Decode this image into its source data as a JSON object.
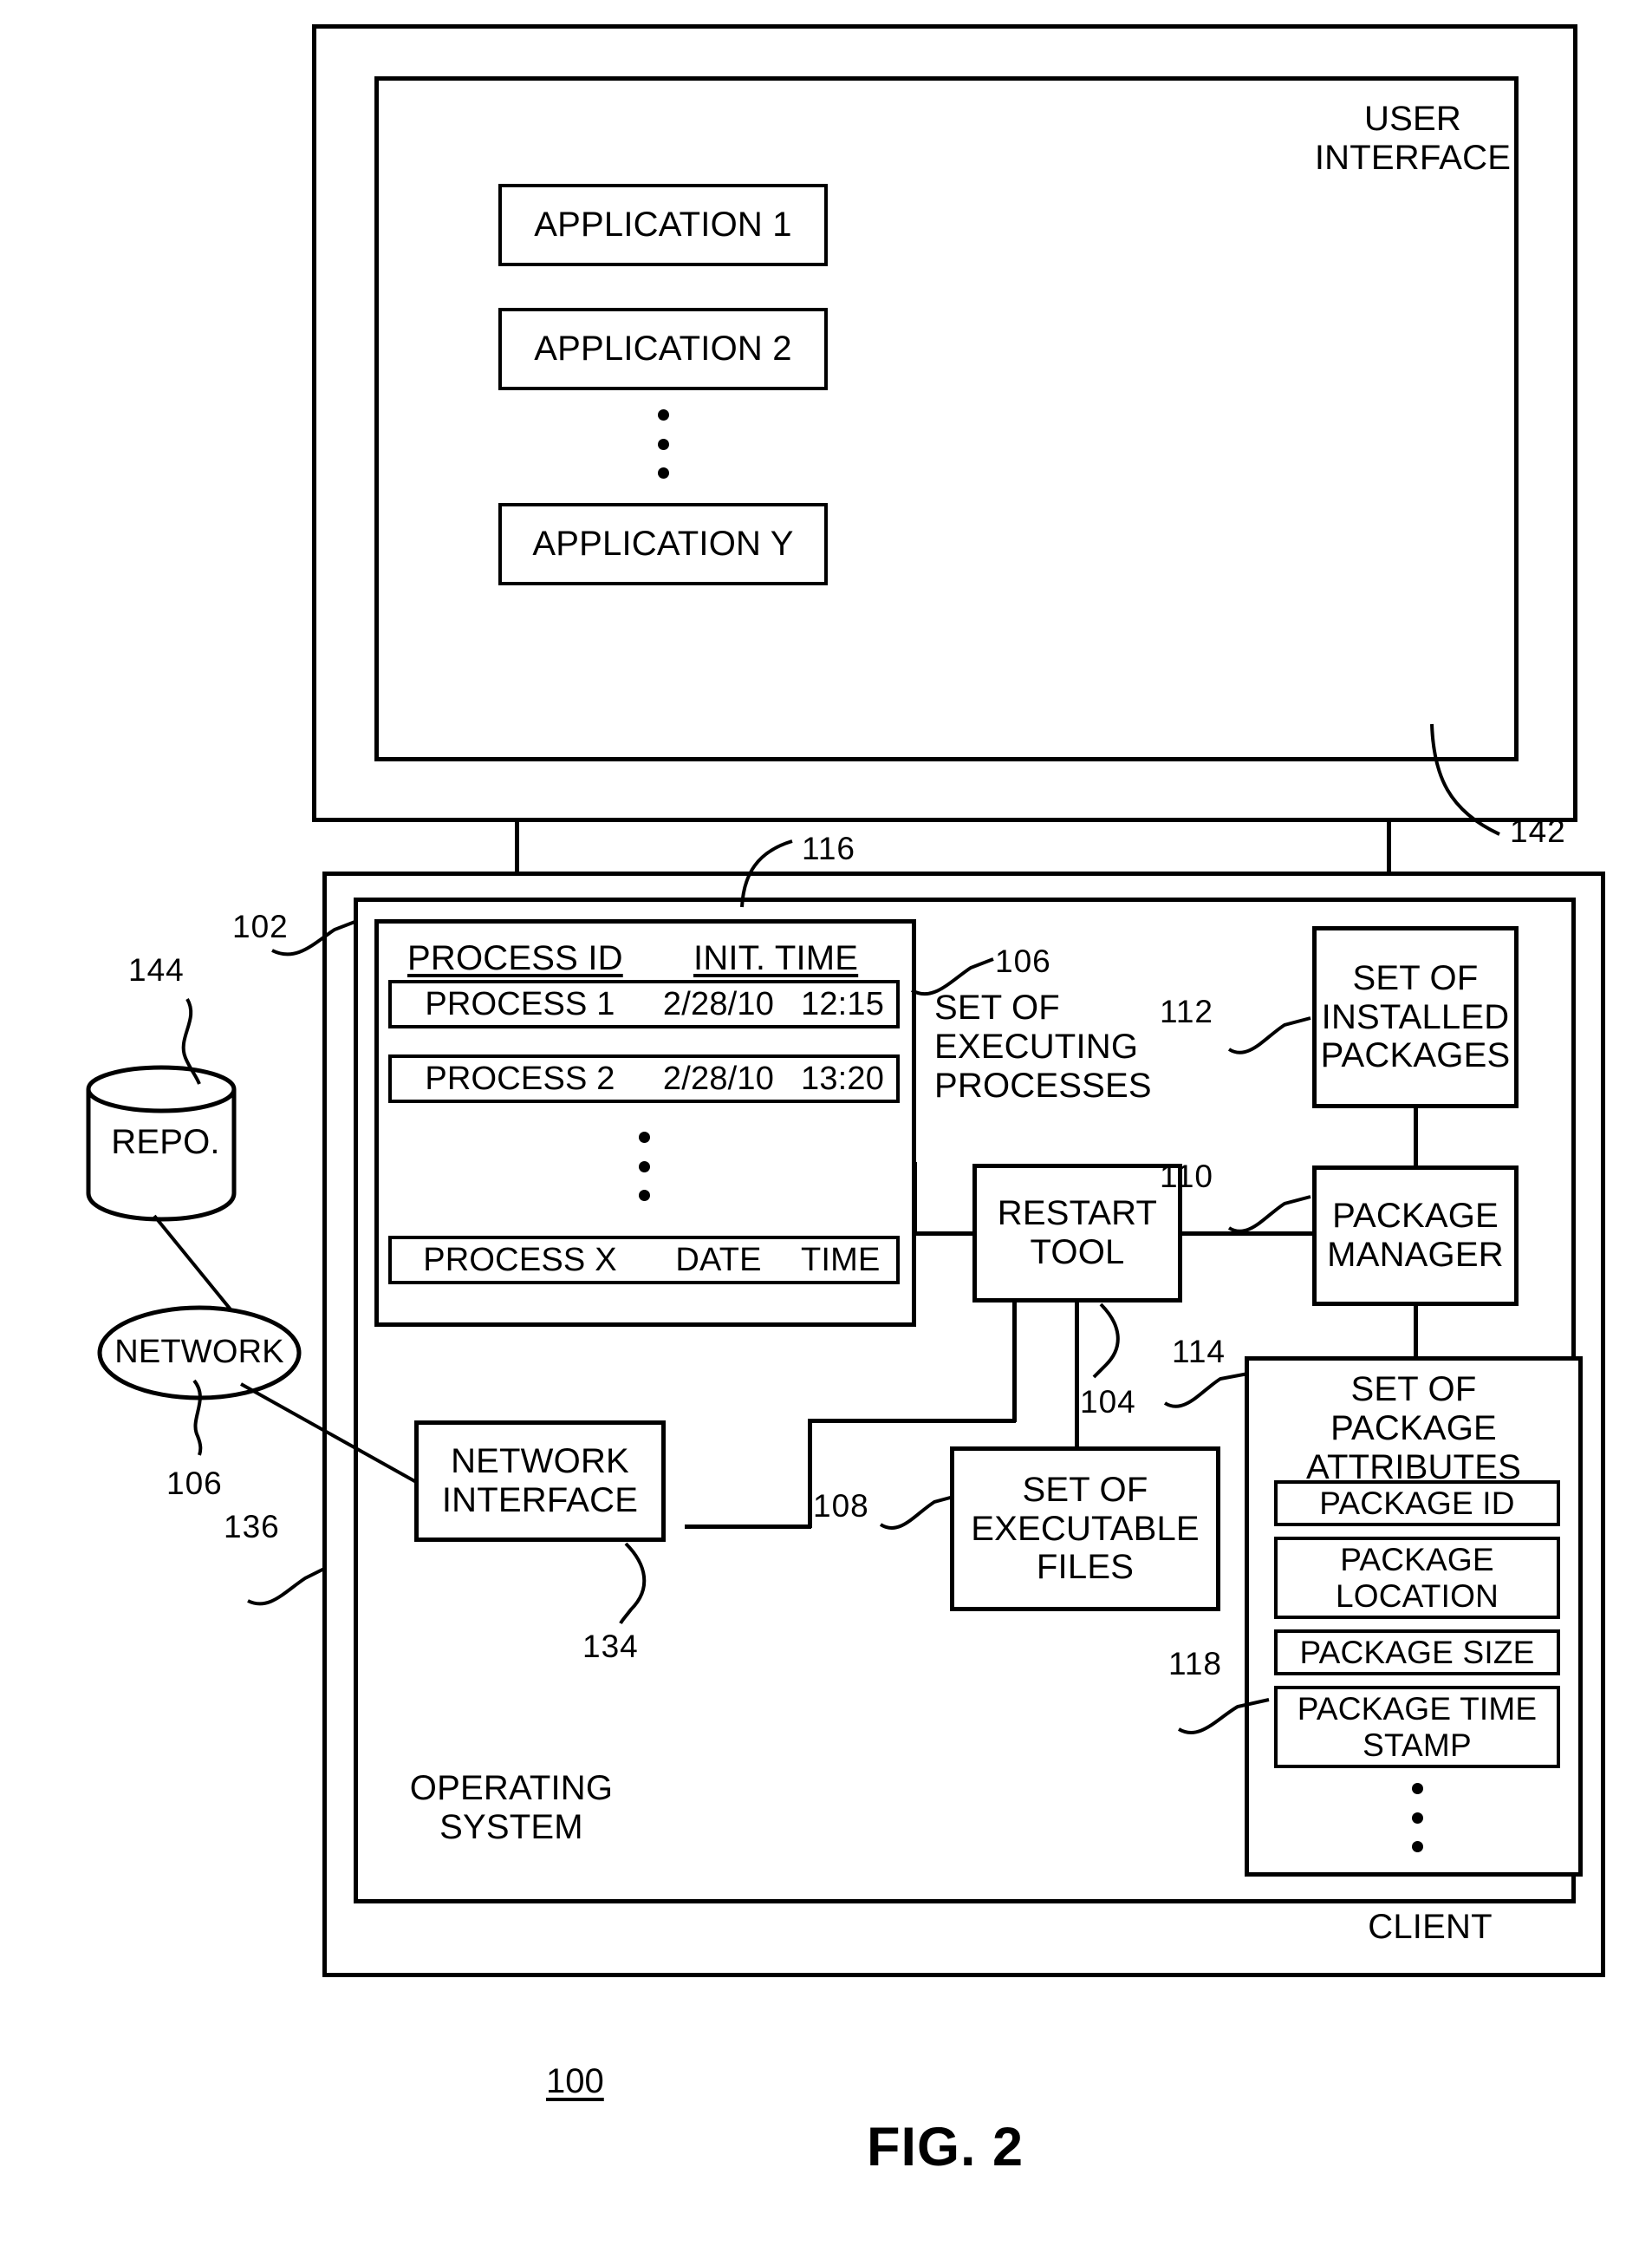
{
  "figure": {
    "caption": "FIG. 2",
    "system_number": "100"
  },
  "user_interface_panel": {
    "title": "USER\nINTERFACE",
    "ref": "142",
    "applications": [
      {
        "label": "APPLICATION 1"
      },
      {
        "label": "APPLICATION 2"
      },
      {
        "label": "APPLICATION Y"
      }
    ],
    "ellipsis": "⋮"
  },
  "client_panel": {
    "label": "CLIENT",
    "ref": "136"
  },
  "operating_system": {
    "label": "OPERATING\nSYSTEM",
    "ref": "102"
  },
  "executing_processes": {
    "ref_set": "106",
    "ref_init_time": "116",
    "caption": "SET OF\nEXECUTING\nPROCESSES",
    "columns": [
      "PROCESS ID",
      "INIT. TIME"
    ],
    "rows": [
      {
        "process_id": "PROCESS 1",
        "date": "2/28/10",
        "time": "12:15"
      },
      {
        "process_id": "PROCESS 2",
        "date": "2/28/10",
        "time": "13:20"
      },
      {
        "process_id": "PROCESS X",
        "date": "DATE",
        "time": "TIME"
      }
    ],
    "ellipsis": "⋮"
  },
  "restart_tool": {
    "label": "RESTART\nTOOL",
    "ref": "104"
  },
  "package_manager": {
    "label": "PACKAGE\nMANAGER",
    "ref": "110"
  },
  "installed_packages": {
    "label": "SET OF\nINSTALLED\nPACKAGES",
    "ref": "112"
  },
  "package_attributes": {
    "title": "SET OF\nPACKAGE\nATTRIBUTES",
    "ref": "114",
    "ref_timestamp": "118",
    "items": [
      {
        "label": "PACKAGE ID"
      },
      {
        "label": "PACKAGE\nLOCATION"
      },
      {
        "label": "PACKAGE SIZE"
      },
      {
        "label": "PACKAGE TIME\nSTAMP"
      }
    ],
    "ellipsis": "⋮"
  },
  "executable_files": {
    "label": "SET OF\nEXECUTABLE\nFILES",
    "ref": "108"
  },
  "network_interface": {
    "label": "NETWORK\nINTERFACE",
    "ref": "134"
  },
  "network": {
    "label": "NETWORK",
    "ref": "106"
  },
  "repository": {
    "label": "REPO.",
    "ref": "144"
  },
  "colors": {
    "stroke": "#000000",
    "background": "#ffffff"
  }
}
